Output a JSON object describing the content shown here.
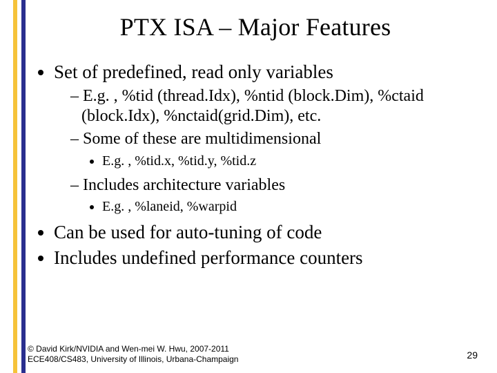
{
  "title": "PTX ISA – Major Features",
  "bullets": {
    "b1": "Set of predefined, read only variables",
    "b1s1": "E.g. , %tid (thread.Idx), %ntid (block.Dim), %ctaid (block.Idx), %nctaid(grid.Dim), etc.",
    "b1s2": "Some of these are multidimensional",
    "b1s2d1": "E.g. , %tid.x, %tid.y, %tid.z",
    "b1s3": "Includes architecture variables",
    "b1s3d1": "E.g. , %laneid, %warpid",
    "b2": "Can be used for auto-tuning of code",
    "b3": "Includes undefined performance counters"
  },
  "footer": {
    "line1": "© David Kirk/NVIDIA and Wen-mei W. Hwu, 2007-2011",
    "line2": "ECE408/CS483, University of Illinois, Urbana-Champaign"
  },
  "page_number": "29"
}
